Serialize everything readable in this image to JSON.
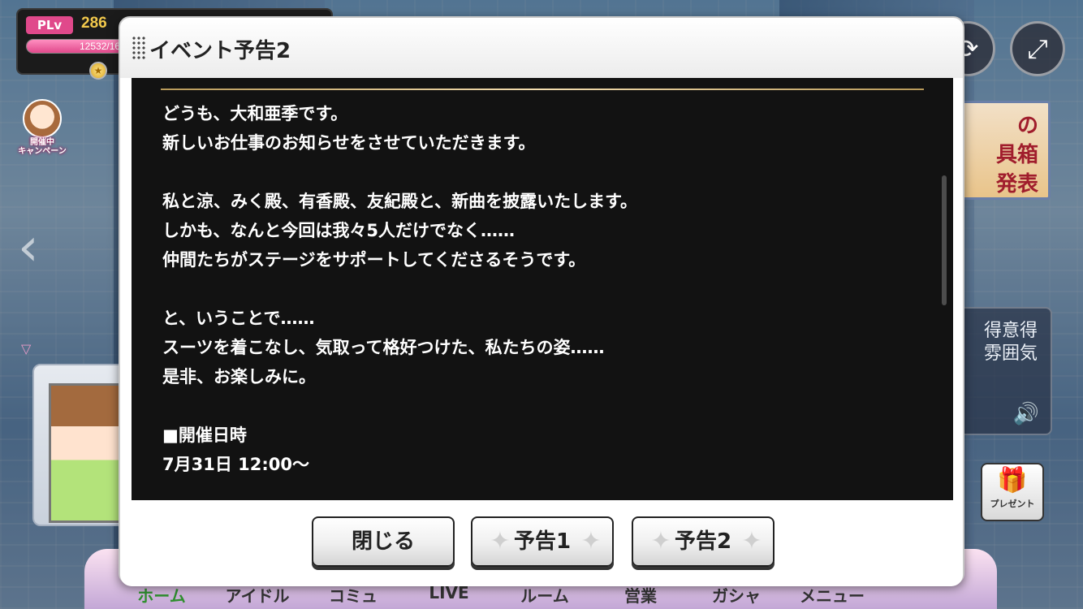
{
  "player": {
    "plv_label": "PLv",
    "level": "286",
    "exp_text": "12532/16",
    "exp_fraction": 0.75
  },
  "campaign": {
    "label_line1": "開催中",
    "label_line2": "キャンペーン"
  },
  "right_panel": {
    "banner_line1": "の",
    "banner_line2": "具箱",
    "banner_line3": "発表",
    "voice_line1": "得意得",
    "voice_line2": "雰囲気"
  },
  "present": {
    "label": "プレゼント"
  },
  "nav": {
    "items": [
      "ホーム",
      "アイドル",
      "コミュ",
      "LIVE",
      "ルーム",
      "営業",
      "ガシャ",
      "メニュー"
    ]
  },
  "dialog": {
    "title": "イベント予告2",
    "lines": [
      "どうも、大和亜季です。",
      "新しいお仕事のお知らせをさせていただきます。",
      "",
      "私と涼、みく殿、有香殿、友紀殿と、新曲を披露いたします。",
      "しかも、なんと今回は我々5人だけでなく……",
      "仲間たちがステージをサポートしてくださるそうです。",
      "",
      "と、いうことで……",
      "スーツを着こなし、気取って格好つけた、私たちの姿……",
      "是非、お楽しみに。",
      "",
      "■開催日時",
      "7月31日 12:00～"
    ],
    "buttons": {
      "close": "閉じる",
      "notice1": "予告1",
      "notice2": "予告2"
    }
  }
}
